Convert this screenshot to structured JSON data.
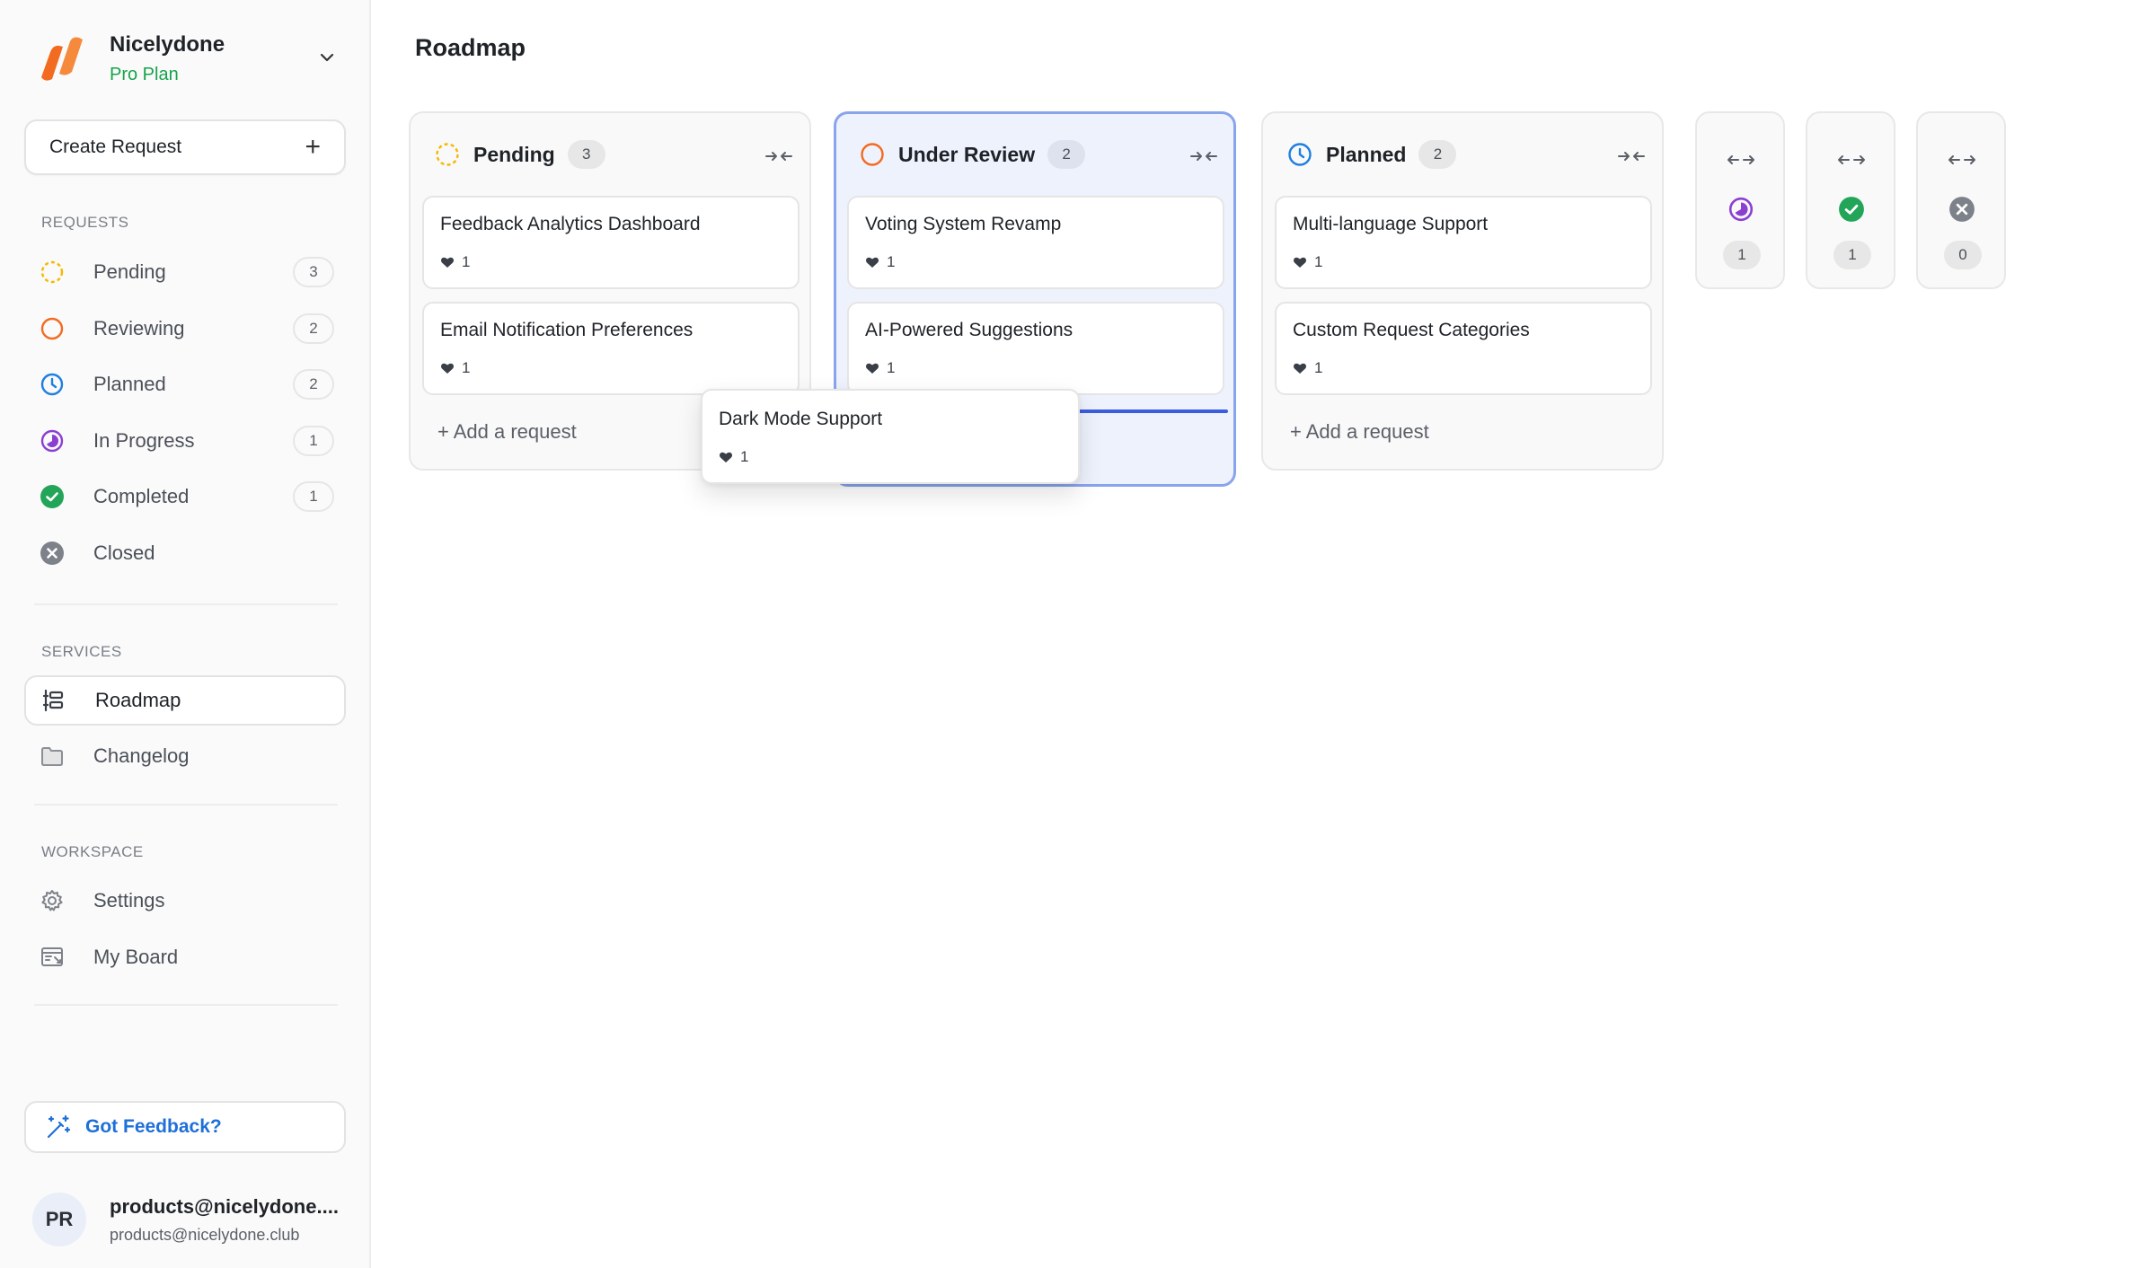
{
  "sidebar": {
    "org": {
      "name": "Nicelydone",
      "plan": "Pro Plan"
    },
    "create_label": "Create Request",
    "sections": {
      "requests": "REQUESTS",
      "services": "SERVICES",
      "workspace": "WORKSPACE"
    },
    "requests": [
      {
        "label": "Pending",
        "count": "3",
        "icon": "pending-dashed-circle-icon"
      },
      {
        "label": "Reviewing",
        "count": "2",
        "icon": "reviewing-circle-icon"
      },
      {
        "label": "Planned",
        "count": "2",
        "icon": "clock-icon"
      },
      {
        "label": "In Progress",
        "count": "1",
        "icon": "half-circle-icon"
      },
      {
        "label": "Completed",
        "count": "1",
        "icon": "check-circle-icon"
      },
      {
        "label": "Closed",
        "count": "",
        "icon": "x-circle-icon"
      }
    ],
    "services": [
      {
        "label": "Roadmap",
        "icon": "roadmap-icon",
        "active": true
      },
      {
        "label": "Changelog",
        "icon": "folder-icon"
      }
    ],
    "workspace": [
      {
        "label": "Settings",
        "icon": "gear-icon"
      },
      {
        "label": "My Board",
        "icon": "board-icon"
      }
    ],
    "feedback_label": "Got Feedback?",
    "user": {
      "initials": "PR",
      "name": "products@nicelydone....",
      "email": "products@nicelydone.club"
    }
  },
  "main": {
    "title": "Roadmap",
    "columns": [
      {
        "name": "Pending",
        "count": "3",
        "cards": [
          {
            "title": "Feedback Analytics Dashboard",
            "votes": "1"
          },
          {
            "title": "Email Notification Preferences",
            "votes": "1"
          }
        ],
        "add_label": "+ Add a request"
      },
      {
        "name": "Under Review",
        "count": "2",
        "cards": [
          {
            "title": "Voting System Revamp",
            "votes": "1"
          },
          {
            "title": "AI-Powered Suggestions",
            "votes": "1"
          }
        ]
      },
      {
        "name": "Planned",
        "count": "2",
        "cards": [
          {
            "title": "Multi-language Support",
            "votes": "1"
          },
          {
            "title": "Custom Request Categories",
            "votes": "1"
          }
        ],
        "add_label": "+ Add a request"
      }
    ],
    "collapsed_columns": [
      {
        "status": "In Progress",
        "count": "1"
      },
      {
        "status": "Completed",
        "count": "1"
      },
      {
        "status": "Closed",
        "count": "0"
      }
    ],
    "dragging_card": {
      "title": "Dark Mode Support",
      "votes": "1"
    }
  },
  "colors": {
    "pending": "#f5b800",
    "reviewing": "#f26b21",
    "planned": "#1e7fe0",
    "in_progress": "#8b3fd1",
    "completed": "#22a559",
    "closed": "#7d828a",
    "accent": "#3b5ee0",
    "plan_green": "#16a34a"
  }
}
